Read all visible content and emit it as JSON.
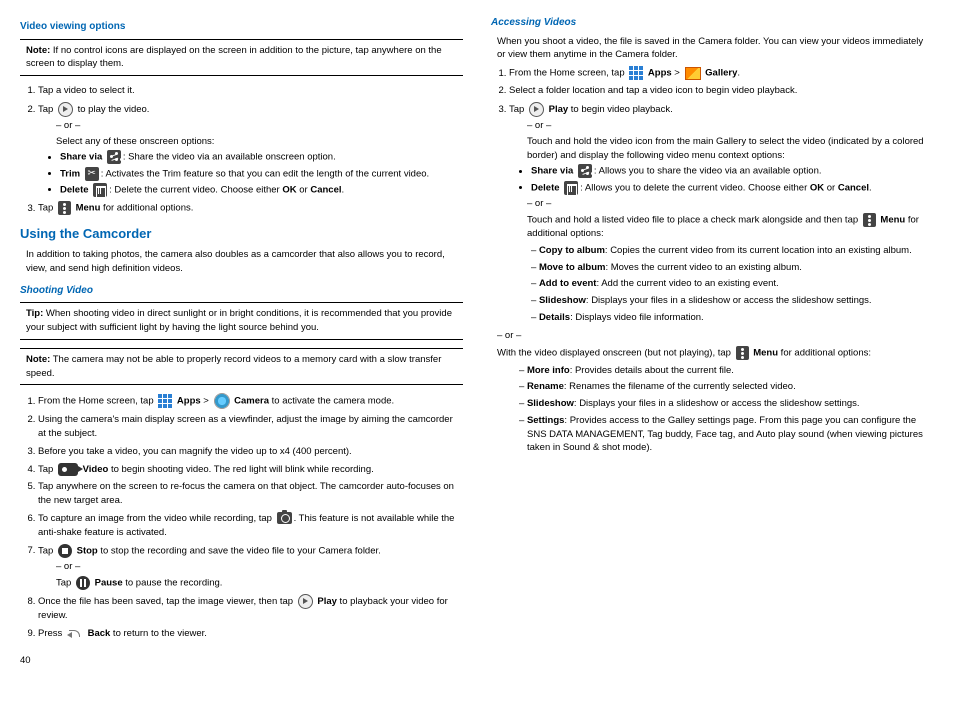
{
  "left": {
    "videoViewingHeading": "Video viewing options",
    "note1_label": "Note:",
    "note1_text": " If no control icons are displayed on the screen in addition to the picture, tap anywhere on the screen to display them.",
    "vv_step1": "Tap a video to select it.",
    "vv_step2_a": "Tap ",
    "vv_step2_b": " to play the video.",
    "or": "– or –",
    "vv_selectOpts": "Select any of these onscreen options:",
    "shareVia": "Share via",
    "shareViaText": ": Share the video via an available onscreen option.",
    "trim": "Trim",
    "trimText": ": Activates the Trim feature so that you can edit the length of the current video.",
    "delete": "Delete",
    "deleteText_a": ": Delete the current video. Choose either ",
    "ok": "OK",
    "or_word": " or ",
    "cancel": "Cancel",
    "vv_step3_a": "Tap ",
    "menu": "Menu",
    "vv_step3_b": " for additional options.",
    "usingCamcorder": "Using the Camcorder",
    "camcorderIntro": "In addition to taking photos, the camera also doubles as a camcorder that also allows you to record, view, and send high definition videos.",
    "shootingVideo": "Shooting Video",
    "tipLabel": "Tip:",
    "tipText": " When shooting video in direct sunlight or in bright conditions, it is recommended that you provide your subject with sufficient light by having the light source behind you.",
    "note2_label": "Note:",
    "note2_text": " The camera may not be able to properly record videos to a memory card with a slow transfer speed.",
    "sv1_a": "From the Home screen, tap ",
    "apps": "Apps",
    "gt": " > ",
    "camera": "Camera",
    "sv1_b": " to activate the camera mode.",
    "sv2": "Using the camera's main display screen as a viewfinder, adjust the image by aiming the camcorder at the subject.",
    "sv3": "Before you take a video, you can magnify the video up to x4 (400 percent).",
    "sv4_a": "Tap ",
    "video": "Video",
    "sv4_b": " to begin shooting video. The red light will blink while recording.",
    "sv5": "Tap anywhere on the screen to re-focus the camera on that object. The camcorder auto-focuses on the new target area.",
    "sv6_a": "To capture an image from the video while recording, tap ",
    "sv6_b": ". This feature is not available while the anti-shake feature is activated.",
    "sv7_a": "Tap ",
    "stop": "Stop",
    "sv7_b": " to stop the recording and save the video file to your Camera folder.",
    "sv7_pause_a": "Tap ",
    "pause": "Pause",
    "sv7_pause_b": " to pause the recording.",
    "sv8_a": "Once the file has been saved, tap the image viewer, then tap ",
    "play": "Play",
    "sv8_b": " to playback your video for review.",
    "sv9_a": "Press ",
    "back": "Back",
    "sv9_b": " to return to the viewer.",
    "pageNum": "40"
  },
  "right": {
    "accessingVideos": "Accessing Videos",
    "intro": "When you shoot a video, the file is saved in the Camera folder. You can view your videos immediately or view them anytime in the Camera folder.",
    "av1_a": "From the Home screen, tap ",
    "apps": "Apps",
    "gt": " > ",
    "gallery": "Gallery",
    "av2": "Select a folder location and tap a video icon to begin video playback.",
    "av3_a": "Tap ",
    "play": "Play",
    "av3_b": " to begin video playback.",
    "or": "– or –",
    "touchHold1": "Touch and hold the video icon from the main Gallery to select the video (indicated by a colored border) and display the following video menu context options:",
    "shareVia": "Share via",
    "shareViaText": ": Allows you to share the video via an available option.",
    "delete": "Delete",
    "deleteText_a": ": Allows you to delete the current video. Choose either ",
    "ok": "OK",
    "or_word": " or ",
    "cancel": "Cancel",
    "touchHold2_a": "Touch and hold a listed video file to place a check mark alongside and then tap ",
    "menu": "Menu",
    "touchHold2_b": " for additional options:",
    "copyAlbum": "Copy to album",
    "copyAlbumText": ": Copies the current video from its current location into an existing album.",
    "moveAlbum": "Move to album",
    "moveAlbumText": ": Moves the current video to an existing album.",
    "addEvent": "Add to event",
    "addEventText": ": Add the current video to an existing event.",
    "slideshow": "Slideshow",
    "slideshowText": ": Displays your files in a slideshow or access the slideshow settings.",
    "details": "Details",
    "detailsText": ": Displays video file information.",
    "withVideo_a": "With the video displayed onscreen (but not playing), tap ",
    "withVideo_b": " for additional options:",
    "moreInfo": "More info",
    "moreInfoText": ": Provides details about the current file.",
    "rename": "Rename",
    "renameText": ": Renames the filename of the currently selected video.",
    "slideshow2Text": ": Displays your files in a slideshow or access the slideshow settings.",
    "settings": "Settings",
    "settingsText": ": Provides access to the Galley settings page. From this page you can configure the SNS DATA MANAGEMENT, Tag buddy, Face tag, and Auto play sound (when viewing pictures taken in Sound & shot mode)."
  }
}
